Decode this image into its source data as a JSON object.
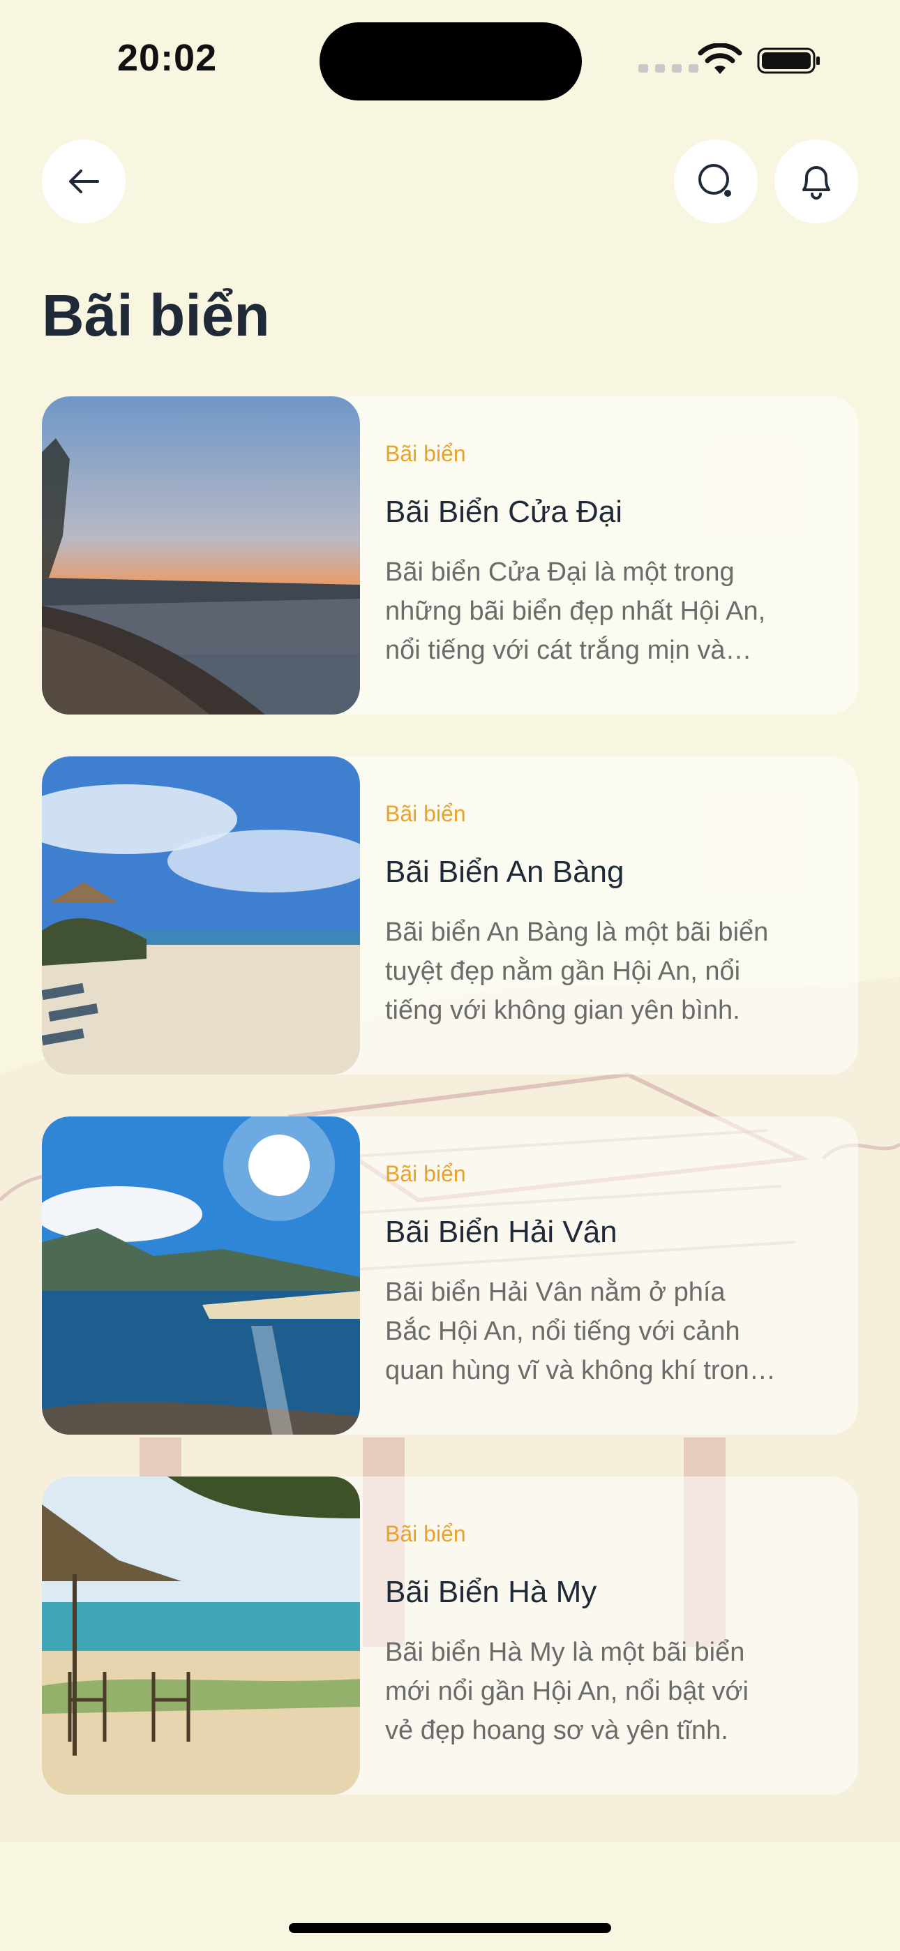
{
  "status_bar": {
    "time": "20:02"
  },
  "header": {
    "back_icon": "arrow-left-icon",
    "search_icon": "search-icon",
    "bell_icon": "bell-icon"
  },
  "page": {
    "title": "Bãi biển"
  },
  "colors": {
    "background": "#f8f5e1",
    "category": "#e8a22b",
    "title": "#1f2937",
    "description": "#6b6b6b"
  },
  "items": [
    {
      "category": "Bãi biển",
      "name": "Bãi Biển Cửa Đại",
      "description": "Bãi biển Cửa Đại là một trong những bãi biển đẹp nhất Hội An, nổi tiếng với cát trắng mịn và nước biển trong xanh."
    },
    {
      "category": "Bãi biển",
      "name": "Bãi Biển An Bàng",
      "description": "Bãi biển An Bàng là một bãi biển tuyệt đẹp nằm gần Hội An, nổi tiếng với không gian yên bình."
    },
    {
      "category": "Bãi biển",
      "name": "Bãi Biển Hải Vân",
      "description": "Bãi biển Hải Vân nằm ở phía Bắc Hội An, nổi tiếng với cảnh quan hùng vĩ và không khí trong lành."
    },
    {
      "category": "Bãi biển",
      "name": "Bãi Biển Hà My",
      "description": "Bãi biển Hà My là một bãi biển mới nổi gần Hội An, nổi bật với vẻ đẹp hoang sơ và yên tĩnh."
    }
  ]
}
